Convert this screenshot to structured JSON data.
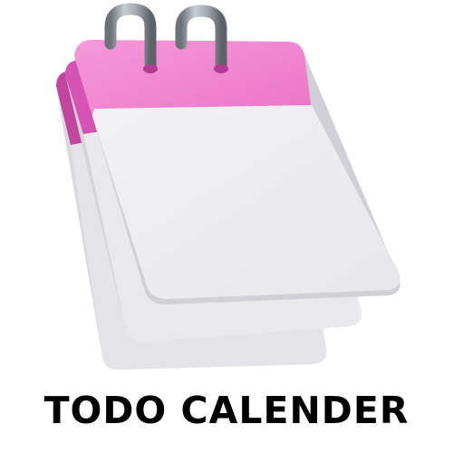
{
  "app": {
    "title": "TODO CALENDER"
  },
  "illustration": {
    "icon": "calendar-icon",
    "colors": {
      "header_pink": "#f07fd0",
      "header_pink_dark": "#c84ca8",
      "page_white": "#ededf0",
      "page_shadow": "#d5d5da",
      "ring_metal": "#9aa0a8"
    }
  }
}
